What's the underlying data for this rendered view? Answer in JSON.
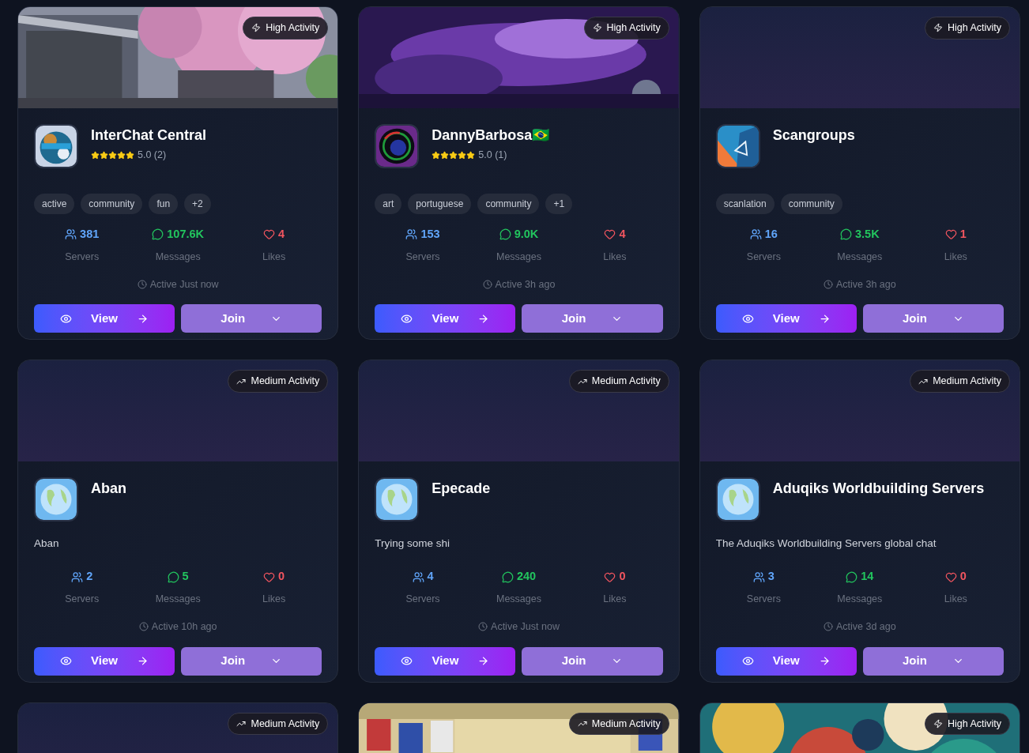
{
  "cards": [
    {
      "banner": {
        "kind": "blossom"
      },
      "activity": {
        "kind": "high",
        "label": "High Activity"
      },
      "avatar": {
        "kind": "picture"
      },
      "name": "InterChat Central",
      "rating": {
        "stars": 5,
        "text": "5.0 (2)"
      },
      "tags": [
        "active",
        "community",
        "fun",
        "+2"
      ],
      "stats": [
        {
          "kind": "servers",
          "value": "381",
          "label": "Servers"
        },
        {
          "kind": "messages",
          "value": "107.6K",
          "label": "Messages"
        },
        {
          "kind": "likes",
          "value": "4",
          "label": "Likes"
        }
      ],
      "active": "Active Just now",
      "view": "View",
      "join": "Join"
    },
    {
      "banner": {
        "kind": "galaxy"
      },
      "activity": {
        "kind": "high",
        "label": "High Activity"
      },
      "avatar": {
        "kind": "art"
      },
      "name": "DannyBarbosa🇧🇷",
      "rating": {
        "stars": 5,
        "text": "5.0 (1)"
      },
      "tags": [
        "art",
        "portuguese",
        "community",
        "+1"
      ],
      "stats": [
        {
          "kind": "servers",
          "value": "153",
          "label": "Servers"
        },
        {
          "kind": "messages",
          "value": "9.0K",
          "label": "Messages"
        },
        {
          "kind": "likes",
          "value": "4",
          "label": "Likes"
        }
      ],
      "active": "Active 3h ago",
      "view": "View",
      "join": "Join"
    },
    {
      "banner": {
        "kind": "plain"
      },
      "activity": {
        "kind": "high",
        "label": "High Activity"
      },
      "avatar": {
        "kind": "logo"
      },
      "name": "Scangroups",
      "tags": [
        "scanlation",
        "community"
      ],
      "stats": [
        {
          "kind": "servers",
          "value": "16",
          "label": "Servers"
        },
        {
          "kind": "messages",
          "value": "3.5K",
          "label": "Messages"
        },
        {
          "kind": "likes",
          "value": "1",
          "label": "Likes"
        }
      ],
      "active": "Active 3h ago",
      "view": "View",
      "join": "Join"
    },
    {
      "banner": {
        "kind": "plain"
      },
      "activity": {
        "kind": "medium",
        "label": "Medium Activity"
      },
      "avatar": {
        "kind": "globe"
      },
      "name": "Aban",
      "description": "Aban",
      "stats": [
        {
          "kind": "servers",
          "value": "2",
          "label": "Servers"
        },
        {
          "kind": "messages",
          "value": "5",
          "label": "Messages"
        },
        {
          "kind": "likes",
          "value": "0",
          "label": "Likes"
        }
      ],
      "active": "Active 10h ago",
      "view": "View",
      "join": "Join"
    },
    {
      "banner": {
        "kind": "plain"
      },
      "activity": {
        "kind": "medium",
        "label": "Medium Activity"
      },
      "avatar": {
        "kind": "globe"
      },
      "name": "Epecade",
      "description": "Trying some shi",
      "stats": [
        {
          "kind": "servers",
          "value": "4",
          "label": "Servers"
        },
        {
          "kind": "messages",
          "value": "240",
          "label": "Messages"
        },
        {
          "kind": "likes",
          "value": "0",
          "label": "Likes"
        }
      ],
      "active": "Active Just now",
      "view": "View",
      "join": "Join"
    },
    {
      "banner": {
        "kind": "plain"
      },
      "activity": {
        "kind": "medium",
        "label": "Medium Activity"
      },
      "avatar": {
        "kind": "globe"
      },
      "name": "Aduqiks Worldbuilding Servers",
      "description": "The Aduqiks Worldbuilding Servers global chat",
      "stats": [
        {
          "kind": "servers",
          "value": "3",
          "label": "Servers"
        },
        {
          "kind": "messages",
          "value": "14",
          "label": "Messages"
        },
        {
          "kind": "likes",
          "value": "0",
          "label": "Likes"
        }
      ],
      "active": "Active 3d ago",
      "view": "View",
      "join": "Join"
    },
    {
      "banner": {
        "kind": "plain"
      },
      "activity": {
        "kind": "medium",
        "label": "Medium Activity"
      }
    },
    {
      "banner": {
        "kind": "flags"
      },
      "activity": {
        "kind": "medium",
        "label": "Medium Activity"
      }
    },
    {
      "banner": {
        "kind": "waves"
      },
      "activity": {
        "kind": "high",
        "label": "High Activity"
      }
    }
  ]
}
